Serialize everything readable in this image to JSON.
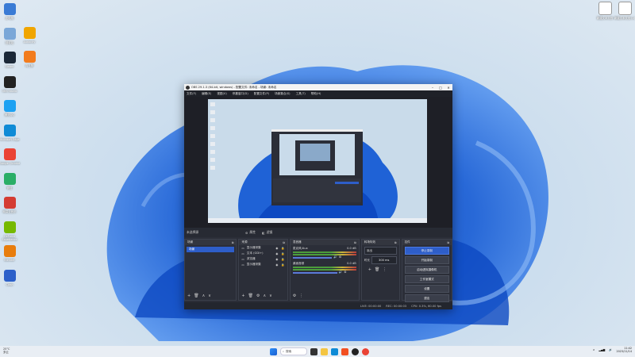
{
  "desktop": {
    "left_icons": [
      {
        "label": "此电脑",
        "icon": "pc-icon",
        "color": "#3a7bd5"
      },
      {
        "label": "回收站",
        "icon": "recycle-bin-icon",
        "color": "#7aa7d8"
      },
      {
        "label": "Steam",
        "icon": "steam-icon",
        "color": "#1b2838"
      },
      {
        "label": "OBS Studio",
        "icon": "obs-icon",
        "color": "#222222"
      },
      {
        "label": "腾讯QQ",
        "icon": "qq-icon",
        "color": "#1da1f2"
      },
      {
        "label": "Microsoft Edge",
        "icon": "edge-icon",
        "color": "#0f8bd6"
      },
      {
        "label": "Google Chrome",
        "icon": "chrome-icon",
        "color": "#ea4335"
      },
      {
        "label": "微信",
        "icon": "wechat-icon",
        "color": "#2aae67"
      },
      {
        "label": "网易云音乐",
        "icon": "netease-music-icon",
        "color": "#d43c33"
      },
      {
        "label": "GeForce Experience",
        "icon": "nvidia-icon",
        "color": "#76b900"
      },
      {
        "label": "Blender",
        "icon": "blender-icon",
        "color": "#e87d0d"
      },
      {
        "label": "Clash",
        "icon": "clash-icon",
        "color": "#2b5fc9"
      }
    ],
    "left_icons_col2": [
      {
        "label": "Audacity",
        "icon": "audacity-icon",
        "color": "#f0a500"
      },
      {
        "label": "向日葵",
        "icon": "sunflower-icon",
        "color": "#f27c1e"
      }
    ],
    "right_icons": [
      {
        "label": "新建文本文档",
        "icon": "text-file-icon",
        "color": "#ffffff"
      },
      {
        "label": "新建文本文档 (2)",
        "icon": "text-file-icon",
        "color": "#ffffff"
      }
    ]
  },
  "obs": {
    "title": "OBS 29.1.3 (64-bit, windows) - 配置文件: 未命名 - 场景: 未命名",
    "menu": [
      "文件(F)",
      "编辑(E)",
      "视图(V)",
      "停靠窗口(D)",
      "配置文件(P)",
      "场景集合(S)",
      "工具(T)",
      "帮助(H)"
    ],
    "source_selected": "未选择源",
    "toolbar": {
      "properties": "属性",
      "filters": "滤镜"
    },
    "scenes": {
      "title": "场景",
      "items": [
        "场景"
      ]
    },
    "sources": {
      "title": "来源",
      "items": [
        {
          "icon": "monitor-icon",
          "label": "显示器采集"
        },
        {
          "icon": "window-icon",
          "label": "文本 (GDI+)"
        },
        {
          "icon": "browser-icon",
          "label": "浏览器"
        },
        {
          "icon": "display-icon",
          "label": "显示器采集"
        }
      ]
    },
    "mixer": {
      "title": "混音器",
      "channels": [
        {
          "name": "麦克风/Aux",
          "db": "0.0 dB",
          "level": 0.62
        },
        {
          "name": "桌面音频",
          "db": "0.0 dB",
          "level": 0.7
        }
      ]
    },
    "transitions": {
      "title": "转场特效",
      "type": "淡出",
      "duration_label": "时长",
      "duration": "300 ms"
    },
    "controls": {
      "title": "控件",
      "buttons": [
        "停止录制",
        "开始录制",
        "启动虚拟摄像机",
        "工作室模式",
        "设置",
        "退出"
      ],
      "active_index": 0
    },
    "status": {
      "live": "LIVE: 00:00:00",
      "rec": "REC: 00:00:03",
      "cpu": "CPU: 0.3%, 60.00 fps"
    }
  },
  "taskbar": {
    "weather_temp": "25°C",
    "weather_desc": "多云",
    "search_label": "搜索",
    "apps": [
      "start-icon",
      "search-icon",
      "explorer-icon",
      "edge-icon",
      "obs-icon",
      "chrome-icon"
    ],
    "time": "11:42",
    "date": "2023/11/14"
  },
  "colors": {
    "accent": "#2e5ec9",
    "obs_bg": "#2b2e38",
    "bloom": "#1f62d6"
  }
}
